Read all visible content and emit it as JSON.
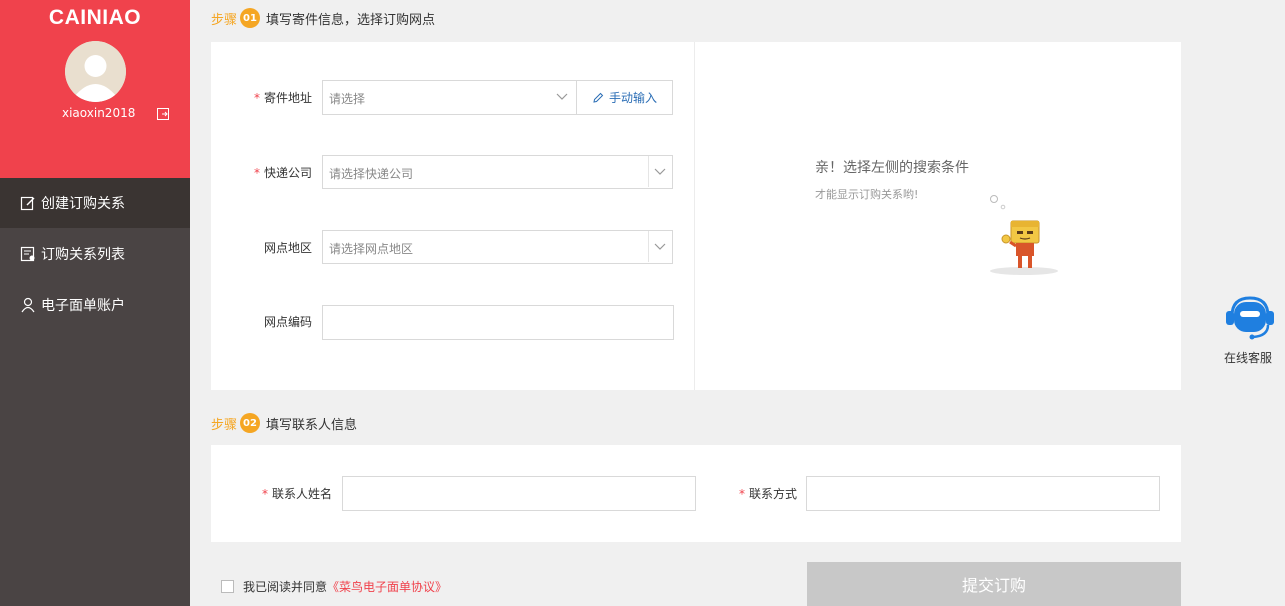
{
  "sidebar": {
    "brand": "CAINIAO",
    "username": "xiaoxin2018",
    "nav": [
      {
        "label": "创建订购关系"
      },
      {
        "label": "订购关系列表"
      },
      {
        "label": "电子面单账户"
      }
    ]
  },
  "step1": {
    "word": "步骤",
    "num": "01",
    "title": "填写寄件信息，选择订购网点",
    "fields": {
      "address": {
        "label": "寄件地址",
        "placeholder": "请选择"
      },
      "manual_input": "手动输入",
      "courier": {
        "label": "快递公司",
        "placeholder": "请选择快递公司"
      },
      "region": {
        "label": "网点地区",
        "placeholder": "请选择网点地区"
      },
      "code": {
        "label": "网点编码",
        "value": ""
      }
    },
    "empty_state": {
      "title": "亲！选择左侧的搜索条件",
      "subtitle": "才能显示订购关系哟!"
    }
  },
  "step2": {
    "word": "步骤",
    "num": "02",
    "title": "填写联系人信息",
    "fields": {
      "contact_name": {
        "label": "联系人姓名",
        "value": ""
      },
      "contact_method": {
        "label": "联系方式",
        "value": ""
      }
    }
  },
  "agreement": {
    "prefix": "我已阅读并同意",
    "link": "《菜鸟电子面单协议》"
  },
  "submit_label": "提交订购",
  "online_service": "在线客服",
  "colors": {
    "brand_red": "#f0424c",
    "sidebar_dark": "#4a4444",
    "step_orange": "#f5a623",
    "service_blue": "#1f7fe0",
    "link_blue": "#2a6db5"
  }
}
